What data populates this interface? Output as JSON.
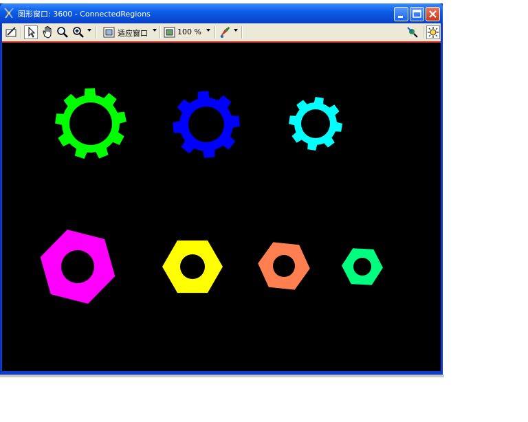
{
  "window": {
    "title": "图形窗口: 3600 - ConnectedRegions",
    "minimize_icon": "minimize-icon",
    "maximize_icon": "maximize-icon",
    "close_icon": "close-icon"
  },
  "toolbar": {
    "zoom_fit_label": "适应窗口",
    "zoom_percent": "100 %",
    "icons": [
      "draw-icon",
      "pointer-icon",
      "pan-hand-icon",
      "magnifier-icon",
      "zoom-in-icon",
      "fit-window-icon",
      "zoom-100-icon",
      "color-tool-icon",
      "inspect-icon",
      "settings-icon"
    ]
  },
  "colors": {
    "gear_large": "#00ff00",
    "gear_medium": "#0000ff",
    "gear_small": "#00ffff",
    "nut_large": "#ff00ff",
    "nut_yellow": "#ffff00",
    "nut_coral": "#ff7f50",
    "nut_small": "#00ff7f",
    "background": "#000000"
  },
  "regions": [
    {
      "name": "gear-green",
      "shape": "gear",
      "color": "#00ff00"
    },
    {
      "name": "gear-blue",
      "shape": "gear",
      "color": "#0000ff"
    },
    {
      "name": "gear-cyan",
      "shape": "gear",
      "color": "#00ffff"
    },
    {
      "name": "nut-magenta",
      "shape": "hexagon-nut",
      "color": "#ff00ff"
    },
    {
      "name": "nut-yellow",
      "shape": "hexagon-nut",
      "color": "#ffff00"
    },
    {
      "name": "nut-coral",
      "shape": "hexagon-nut",
      "color": "#ff7f50"
    },
    {
      "name": "nut-spring-green",
      "shape": "hexagon-nut",
      "color": "#00ff7f"
    }
  ]
}
